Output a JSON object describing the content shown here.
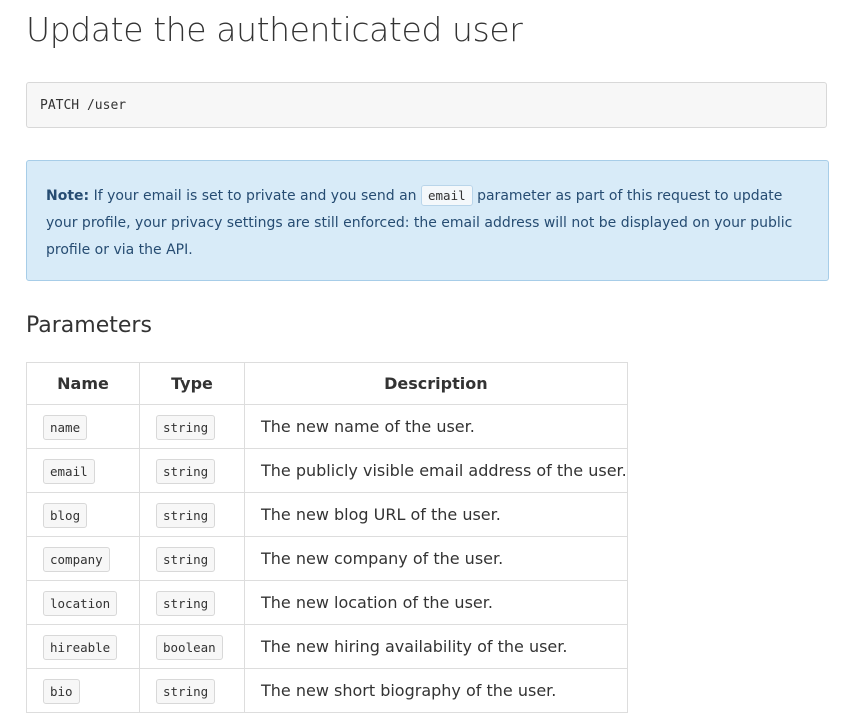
{
  "page_title": "Update the authenticated user",
  "endpoint": "PATCH /user",
  "note": {
    "label": "Note:",
    "text_before": " If your email is set to private and you send an ",
    "code": "email",
    "text_after": " parameter as part of this request to update your profile, your privacy settings are still enforced: the email address will not be displayed on your public profile or via the API."
  },
  "parameters": {
    "heading": "Parameters",
    "columns": {
      "name": "Name",
      "type": "Type",
      "description": "Description"
    },
    "rows": [
      {
        "name": "name",
        "type": "string",
        "description": "The new name of the user."
      },
      {
        "name": "email",
        "type": "string",
        "description": "The publicly visible email address of the user."
      },
      {
        "name": "blog",
        "type": "string",
        "description": "The new blog URL of the user."
      },
      {
        "name": "company",
        "type": "string",
        "description": "The new company of the user."
      },
      {
        "name": "location",
        "type": "string",
        "description": "The new location of the user."
      },
      {
        "name": "hireable",
        "type": "boolean",
        "description": "The new hiring availability of the user."
      },
      {
        "name": "bio",
        "type": "string",
        "description": "The new short biography of the user."
      }
    ]
  }
}
